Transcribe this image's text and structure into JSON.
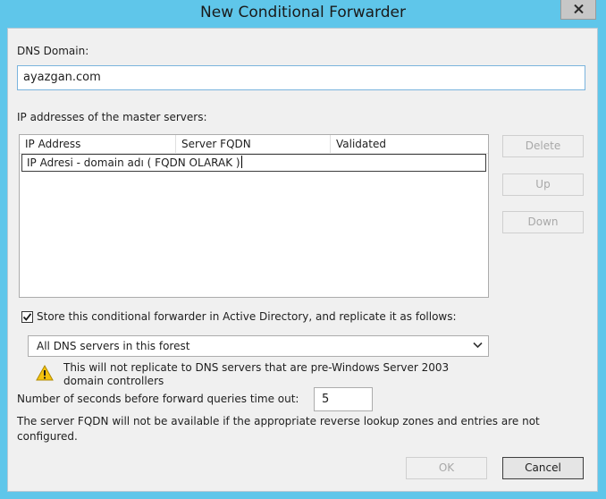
{
  "window": {
    "title": "New Conditional Forwarder"
  },
  "dns_domain": {
    "label": "DNS Domain:",
    "value": "ayazgan.com"
  },
  "master_servers": {
    "label": "IP addresses of the master servers:",
    "columns": [
      "IP Address",
      "Server FQDN",
      "Validated"
    ],
    "editing_value": "IP Adresi - domain adı ( FQDN OLARAK )"
  },
  "side_buttons": {
    "delete": "Delete",
    "up": "Up",
    "down": "Down"
  },
  "replication": {
    "checkbox_label": "Store this conditional forwarder in Active Directory, and replicate it as follows:",
    "checked": true,
    "scope_selected": "All DNS servers in this forest",
    "warning_line1": "This will not replicate to DNS servers that are pre-Windows Server 2003",
    "warning_line2": "domain controllers"
  },
  "timeout": {
    "label": "Number of seconds before forward queries time out:",
    "value": "5"
  },
  "note": {
    "line1": "The server FQDN will not be available if the appropriate reverse lookup zones and entries are not",
    "line2": "configured."
  },
  "footer_buttons": {
    "ok": "OK",
    "cancel": "Cancel"
  },
  "colors": {
    "frame": "#5fc6ea",
    "client_background": "#f0f0f0",
    "focused_border": "#7ab4dd",
    "warning_yellow": "#f4c20d"
  },
  "icons": [
    "close-icon",
    "checkmark-icon",
    "chevron-down-icon",
    "warning-icon"
  ]
}
